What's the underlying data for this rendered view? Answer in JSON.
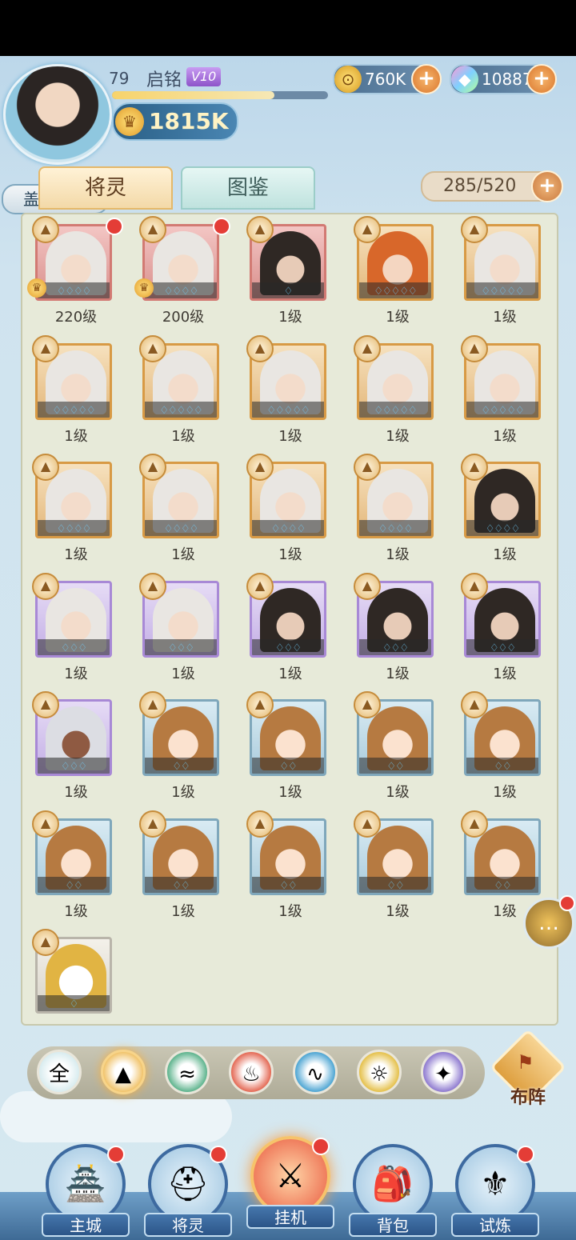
{
  "header": {
    "player_level": "79",
    "player_name": "启铭",
    "vip": "V10",
    "avatar_title": "盖世战神",
    "power": "1815K",
    "coins": "760K",
    "gems": "10887",
    "xp_fraction": 0.75
  },
  "tabs": [
    {
      "label": "将灵",
      "active": true
    },
    {
      "label": "图鉴",
      "active": false
    }
  ],
  "capacity": "285/520",
  "heroes": [
    {
      "level": "220级",
      "frame": "red",
      "hair": "white",
      "dot": true,
      "crown": true,
      "drops": "♢♢♢♢"
    },
    {
      "level": "200级",
      "frame": "red",
      "hair": "white",
      "dot": true,
      "crown": true,
      "drops": "♢♢♢♢"
    },
    {
      "level": "1级",
      "frame": "red",
      "hair": "dark",
      "dot": false,
      "crown": false,
      "drops": "♢"
    },
    {
      "level": "1级",
      "frame": "gold",
      "hair": "orange",
      "dot": false,
      "crown": false,
      "drops": "♢♢♢♢♢"
    },
    {
      "level": "1级",
      "frame": "gold",
      "hair": "white",
      "dot": false,
      "crown": false,
      "drops": "♢♢♢♢♢"
    },
    {
      "level": "1级",
      "frame": "gold",
      "hair": "white",
      "dot": false,
      "crown": false,
      "drops": "♢♢♢♢♢"
    },
    {
      "level": "1级",
      "frame": "gold",
      "hair": "white",
      "dot": false,
      "crown": false,
      "drops": "♢♢♢♢♢"
    },
    {
      "level": "1级",
      "frame": "gold",
      "hair": "white",
      "dot": false,
      "crown": false,
      "drops": "♢♢♢♢♢"
    },
    {
      "level": "1级",
      "frame": "gold",
      "hair": "white",
      "dot": false,
      "crown": false,
      "drops": "♢♢♢♢♢"
    },
    {
      "level": "1级",
      "frame": "gold",
      "hair": "white",
      "dot": false,
      "crown": false,
      "drops": "♢♢♢♢♢"
    },
    {
      "level": "1级",
      "frame": "gold",
      "hair": "white",
      "dot": false,
      "crown": false,
      "drops": "♢♢♢♢"
    },
    {
      "level": "1级",
      "frame": "gold",
      "hair": "white",
      "dot": false,
      "crown": false,
      "drops": "♢♢♢♢"
    },
    {
      "level": "1级",
      "frame": "gold",
      "hair": "white",
      "dot": false,
      "crown": false,
      "drops": "♢♢♢♢"
    },
    {
      "level": "1级",
      "frame": "gold",
      "hair": "white",
      "dot": false,
      "crown": false,
      "drops": "♢♢♢♢"
    },
    {
      "level": "1级",
      "frame": "gold",
      "hair": "dark",
      "dot": false,
      "crown": false,
      "drops": "♢♢♢♢"
    },
    {
      "level": "1级",
      "frame": "purple",
      "hair": "white",
      "dot": false,
      "crown": false,
      "drops": "♢♢♢"
    },
    {
      "level": "1级",
      "frame": "purple",
      "hair": "white",
      "dot": false,
      "crown": false,
      "drops": "♢♢♢"
    },
    {
      "level": "1级",
      "frame": "purple",
      "hair": "dark",
      "dot": false,
      "crown": false,
      "drops": "♢♢♢"
    },
    {
      "level": "1级",
      "frame": "purple",
      "hair": "dark",
      "dot": false,
      "crown": false,
      "drops": "♢♢♢"
    },
    {
      "level": "1级",
      "frame": "purple",
      "hair": "dark",
      "dot": false,
      "crown": false,
      "drops": "♢♢♢"
    },
    {
      "level": "1级",
      "frame": "purple",
      "hair": "silver",
      "dot": false,
      "crown": false,
      "drops": "♢♢♢"
    },
    {
      "level": "1级",
      "frame": "blue",
      "hair": "brown",
      "dot": false,
      "crown": false,
      "drops": "♢♢"
    },
    {
      "level": "1级",
      "frame": "blue",
      "hair": "brown",
      "dot": false,
      "crown": false,
      "drops": "♢♢"
    },
    {
      "level": "1级",
      "frame": "blue",
      "hair": "brown",
      "dot": false,
      "crown": false,
      "drops": "♢♢"
    },
    {
      "level": "1级",
      "frame": "blue",
      "hair": "brown",
      "dot": false,
      "crown": false,
      "drops": "♢♢"
    },
    {
      "level": "1级",
      "frame": "blue",
      "hair": "brown",
      "dot": false,
      "crown": false,
      "drops": "♢♢"
    },
    {
      "level": "1级",
      "frame": "blue",
      "hair": "brown",
      "dot": false,
      "crown": false,
      "drops": "♢♢"
    },
    {
      "level": "1级",
      "frame": "blue",
      "hair": "brown",
      "dot": false,
      "crown": false,
      "drops": "♢♢"
    },
    {
      "level": "1级",
      "frame": "blue",
      "hair": "brown",
      "dot": false,
      "crown": false,
      "drops": "♢♢"
    },
    {
      "level": "1级",
      "frame": "blue",
      "hair": "brown",
      "dot": false,
      "crown": false,
      "drops": "♢♢"
    },
    {
      "level": "",
      "frame": "plain",
      "hair": "mascot",
      "dot": false,
      "crown": false,
      "drops": "♢"
    }
  ],
  "filters": [
    {
      "label": "全",
      "icon": "all-icon",
      "color": "#d9ecef",
      "selected": false
    },
    {
      "label": "",
      "icon": "mountain-icon",
      "color": "#f1c46d",
      "selected": true
    },
    {
      "label": "",
      "icon": "wind-icon",
      "color": "#5fb48e",
      "selected": false
    },
    {
      "label": "",
      "icon": "fire-icon",
      "color": "#e46a56",
      "selected": false
    },
    {
      "label": "",
      "icon": "water-icon",
      "color": "#4fa6d3",
      "selected": false
    },
    {
      "label": "",
      "icon": "sun-icon",
      "color": "#e5c14c",
      "selected": false
    },
    {
      "label": "",
      "icon": "star-icon",
      "color": "#8f7bd0",
      "selected": false
    }
  ],
  "deploy_label": "布阵",
  "nav": [
    {
      "label": "主城",
      "icon": "castle-icon",
      "dot": true,
      "active": false
    },
    {
      "label": "将灵",
      "icon": "warrior-helmet-icon",
      "dot": true,
      "active": false
    },
    {
      "label": "挂机",
      "icon": "crossed-swords-icon",
      "dot": true,
      "active": true
    },
    {
      "label": "背包",
      "icon": "backpack-icon",
      "dot": false,
      "active": false
    },
    {
      "label": "试炼",
      "icon": "banner-icon",
      "dot": true,
      "active": false
    }
  ]
}
